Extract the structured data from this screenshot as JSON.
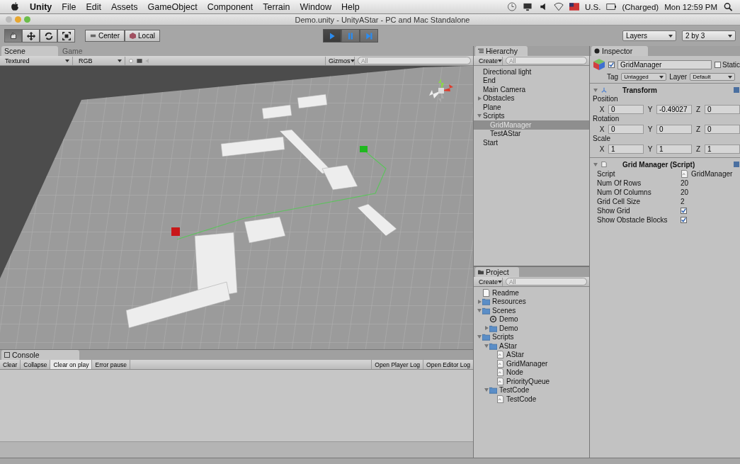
{
  "menu_bar": {
    "app_name": "Unity",
    "items": [
      "File",
      "Edit",
      "Assets",
      "GameObject",
      "Component",
      "Terrain",
      "Window",
      "Help"
    ],
    "locale": "U.S.",
    "battery": "(Charged)",
    "clock": "Mon 12:59 PM"
  },
  "window": {
    "title": "Demo.unity - UnityAStar - PC and Mac Standalone"
  },
  "toolbar": {
    "tools": [
      {
        "kind": "hand",
        "selected": true
      },
      {
        "kind": "move",
        "selected": false
      },
      {
        "kind": "rotate",
        "selected": false
      },
      {
        "kind": "scale",
        "selected": false
      }
    ],
    "pivot_buttons": [
      {
        "kind": "center",
        "label": "Center"
      },
      {
        "kind": "local",
        "label": "Local"
      }
    ],
    "play_buttons": [
      {
        "kind": "play",
        "selected": true
      },
      {
        "kind": "pause",
        "selected": false
      },
      {
        "kind": "step",
        "selected": false
      }
    ],
    "layers": "Layers",
    "layout": "2 by 3"
  },
  "scene_panel": {
    "tabs": [
      {
        "label": "Scene",
        "selected": true
      },
      {
        "label": "Game",
        "selected": false
      }
    ],
    "render_mode": "Textured",
    "channel": "RGB",
    "gizmos": "Gizmos",
    "search_placeholder": "All"
  },
  "hierarchy": {
    "title": "Hierarchy",
    "create": "Create",
    "search_placeholder": "All",
    "items": [
      {
        "label": "Directional light",
        "selected": false
      },
      {
        "label": "End",
        "selected": false
      },
      {
        "label": "Main Camera",
        "selected": false
      },
      {
        "label": "Obstacles",
        "selected": false,
        "expanded": false
      },
      {
        "label": "Plane",
        "selected": false
      },
      {
        "label": "Scripts",
        "selected": false,
        "expanded": true,
        "children": [
          {
            "label": "GridManager",
            "selected": true
          },
          {
            "label": "TestAStar",
            "selected": false
          }
        ]
      },
      {
        "label": "Start",
        "selected": false
      }
    ]
  },
  "project": {
    "title": "Project",
    "create": "Create",
    "search_placeholder": "All",
    "items": [
      {
        "label": "Readme",
        "kind": "text"
      },
      {
        "label": "Resources",
        "kind": "folder",
        "expanded": false
      },
      {
        "label": "Scenes",
        "kind": "folder",
        "expanded": true,
        "children": [
          {
            "label": "Demo",
            "kind": "scene"
          },
          {
            "label": "Demo",
            "kind": "folder",
            "expanded": false
          }
        ]
      },
      {
        "label": "Scripts",
        "kind": "folder",
        "expanded": true,
        "children": [
          {
            "label": "AStar",
            "kind": "folder",
            "expanded": true,
            "children": [
              {
                "label": "AStar",
                "kind": "script"
              },
              {
                "label": "GridManager",
                "kind": "script"
              },
              {
                "label": "Node",
                "kind": "script"
              },
              {
                "label": "PriorityQueue",
                "kind": "script"
              }
            ]
          },
          {
            "label": "TestCode",
            "kind": "folder",
            "expanded": true,
            "children": [
              {
                "label": "TestCode",
                "kind": "script"
              }
            ]
          }
        ]
      }
    ]
  },
  "inspector": {
    "title": "Inspector",
    "object": {
      "active": true,
      "name": "GridManager",
      "static": false,
      "static_label": "Static"
    },
    "tag_label": "Tag",
    "tag": "Untagged",
    "layer_label": "Layer",
    "layer": "Default",
    "transform": {
      "title": "Transform",
      "expanded": true,
      "groups": [
        {
          "label": "Position",
          "fields": [
            {
              "axis": "X",
              "value": "0"
            },
            {
              "axis": "Y",
              "value": "-0.49027"
            },
            {
              "axis": "Z",
              "value": "0"
            }
          ]
        },
        {
          "label": "Rotation",
          "fields": [
            {
              "axis": "X",
              "value": "0"
            },
            {
              "axis": "Y",
              "value": "0"
            },
            {
              "axis": "Z",
              "value": "0"
            }
          ]
        },
        {
          "label": "Scale",
          "fields": [
            {
              "axis": "X",
              "value": "1"
            },
            {
              "axis": "Y",
              "value": "1"
            },
            {
              "axis": "Z",
              "value": "1"
            }
          ]
        }
      ]
    },
    "script": {
      "title": "Grid Manager (Script)",
      "expanded": true,
      "properties": [
        {
          "label": "Script",
          "kind": "object",
          "value": "GridManager"
        },
        {
          "label": "Num Of Rows",
          "kind": "text",
          "value": "20"
        },
        {
          "label": "Num Of Columns",
          "kind": "text",
          "value": "20"
        },
        {
          "label": "Grid Cell Size",
          "kind": "text",
          "value": "2"
        },
        {
          "label": "Show Grid",
          "kind": "checkbox",
          "checked": true
        },
        {
          "label": "Show Obstacle Blocks",
          "kind": "checkbox",
          "checked": true
        }
      ]
    }
  },
  "console": {
    "title": "Console",
    "buttons": [
      {
        "label": "Clear",
        "selected": false
      },
      {
        "label": "Collapse",
        "selected": false
      },
      {
        "label": "Clear on play",
        "selected": true
      },
      {
        "label": "Error pause",
        "selected": false
      }
    ],
    "log_buttons": [
      "Open Player Log",
      "Open Editor Log"
    ]
  }
}
